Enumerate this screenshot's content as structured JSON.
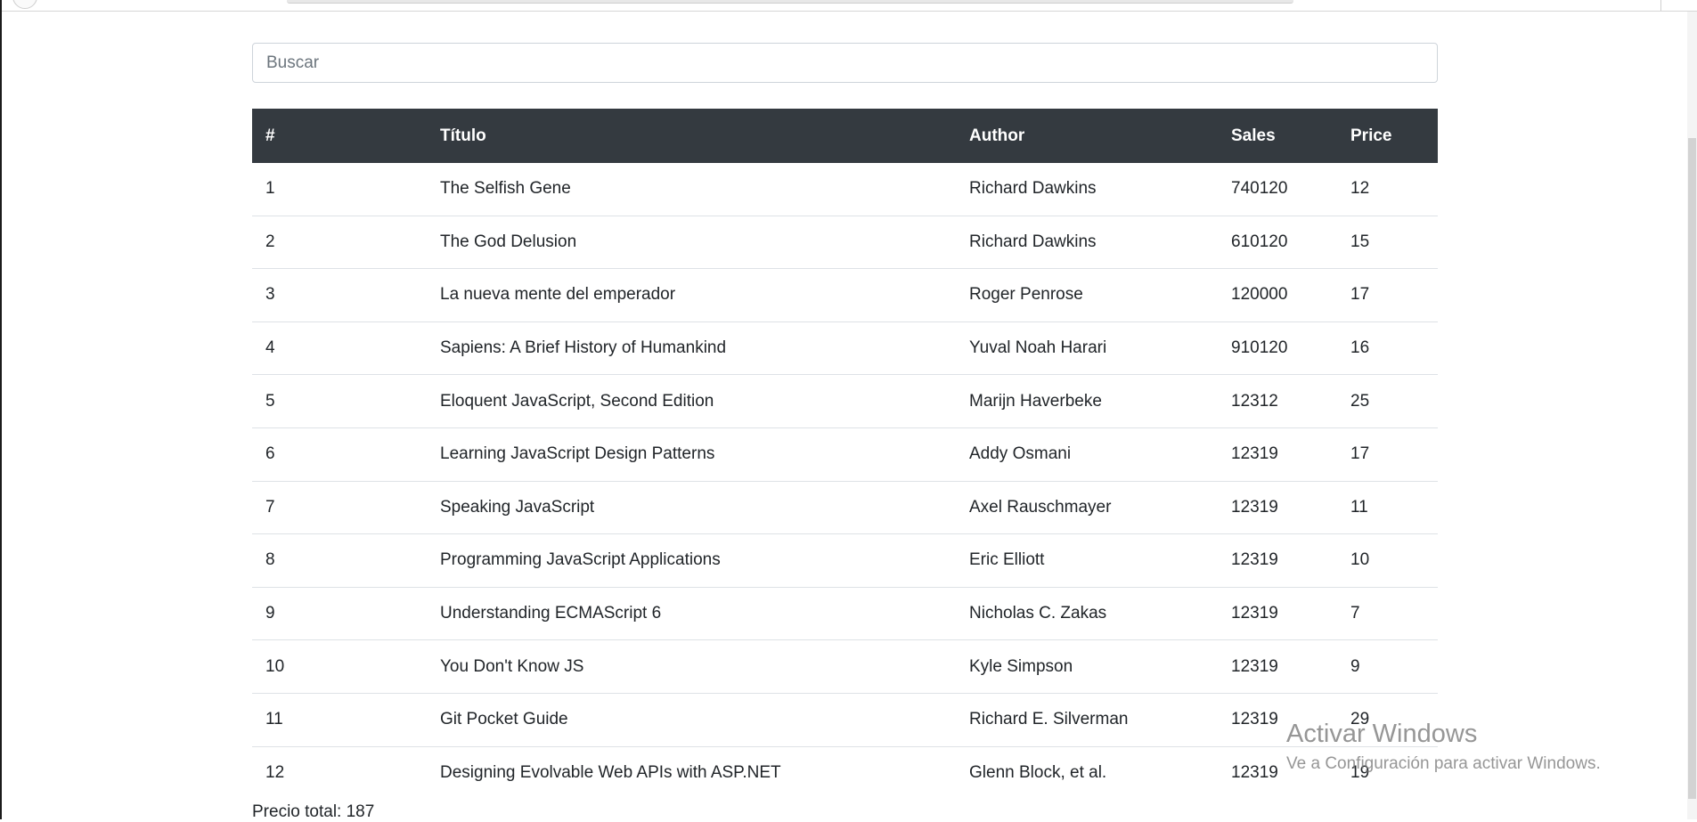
{
  "search": {
    "placeholder": "Buscar",
    "value": ""
  },
  "table": {
    "headers": {
      "index": "#",
      "title": "Título",
      "author": "Author",
      "sales": "Sales",
      "price": "Price"
    },
    "rows": [
      {
        "index": "1",
        "title": "The Selfish Gene",
        "author": "Richard Dawkins",
        "sales": "740120",
        "price": "12"
      },
      {
        "index": "2",
        "title": "The God Delusion",
        "author": "Richard Dawkins",
        "sales": "610120",
        "price": "15"
      },
      {
        "index": "3",
        "title": "La nueva mente del emperador",
        "author": "Roger Penrose",
        "sales": "120000",
        "price": "17"
      },
      {
        "index": "4",
        "title": "Sapiens: A Brief History of Humankind",
        "author": "Yuval Noah Harari",
        "sales": "910120",
        "price": "16"
      },
      {
        "index": "5",
        "title": "Eloquent JavaScript, Second Edition",
        "author": "Marijn Haverbeke",
        "sales": "12312",
        "price": "25"
      },
      {
        "index": "6",
        "title": "Learning JavaScript Design Patterns",
        "author": "Addy Osmani",
        "sales": "12319",
        "price": "17"
      },
      {
        "index": "7",
        "title": "Speaking JavaScript",
        "author": "Axel Rauschmayer",
        "sales": "12319",
        "price": "11"
      },
      {
        "index": "8",
        "title": "Programming JavaScript Applications",
        "author": "Eric Elliott",
        "sales": "12319",
        "price": "10"
      },
      {
        "index": "9",
        "title": "Understanding ECMAScript 6",
        "author": "Nicholas C. Zakas",
        "sales": "12319",
        "price": "7"
      },
      {
        "index": "10",
        "title": "You Don't Know JS",
        "author": "Kyle Simpson",
        "sales": "12319",
        "price": "9"
      },
      {
        "index": "11",
        "title": "Git Pocket Guide",
        "author": "Richard E. Silverman",
        "sales": "12319",
        "price": "29"
      },
      {
        "index": "12",
        "title": "Designing Evolvable Web APIs with ASP.NET",
        "author": "Glenn Block, et al.",
        "sales": "12319",
        "price": "19"
      }
    ]
  },
  "footer": {
    "total_text": "Precio total: 187"
  },
  "watermark": {
    "title": "Activar Windows",
    "subtitle": "Ve a Configuración para activar Windows."
  },
  "colors": {
    "table_header_bg": "#343a40",
    "row_divider": "#dee2e6"
  }
}
